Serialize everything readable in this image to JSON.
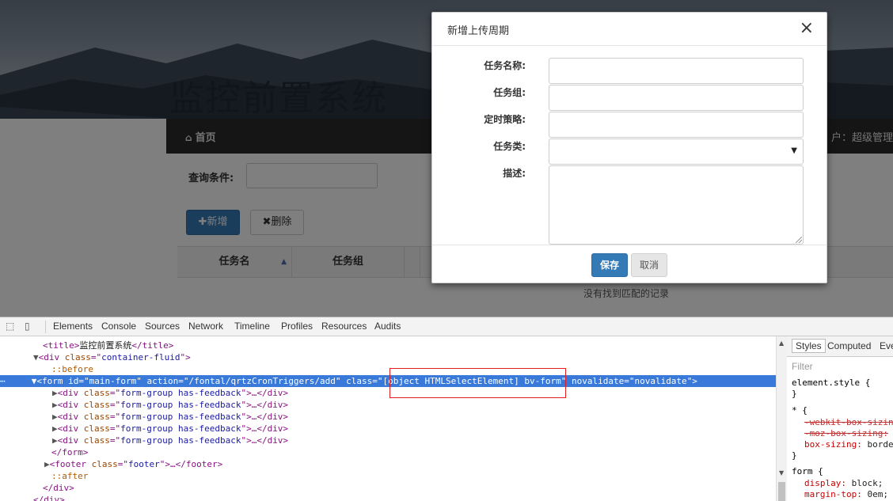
{
  "background": {
    "system_title": "监控前置系统",
    "nav": {
      "home_label": "首页",
      "user_text": "户：超级管理"
    },
    "query_label": "查询条件:",
    "buttons": {
      "add_label": "新增",
      "delete_label": "删除"
    },
    "table": {
      "headers": [
        "任务名",
        "任务组"
      ],
      "empty_text": "没有找到匹配的记录"
    }
  },
  "modal": {
    "title": "新增上传周期",
    "close_glyph": "×",
    "fields": [
      {
        "label": "任务名称:",
        "value": ""
      },
      {
        "label": "任务组:",
        "value": ""
      },
      {
        "label": "定时策略:",
        "value": ""
      },
      {
        "label": "任务类:",
        "value": ""
      },
      {
        "label": "描述:",
        "value": ""
      }
    ],
    "save_label": "保存",
    "cancel_label": "取消"
  },
  "devtools": {
    "tabs": [
      "Elements",
      "Console",
      "Sources",
      "Network",
      "Timeline",
      "Profiles",
      "Resources",
      "Audits"
    ],
    "dom": {
      "title_text": "监控前置系统",
      "container_class": "container-fluid",
      "before": "::before",
      "form_id": "main-form",
      "form_action": "/fontal/qrtzCronTriggers/add",
      "form_class": "[object HTMLSelectElement] bv-form",
      "form_novalidate": "novalidate",
      "form_group_class": "form-group has-feedback",
      "footer_class": "footer",
      "after": "::after"
    },
    "styles_panel": {
      "tabs": [
        "Styles",
        "Computed",
        "Eve"
      ],
      "filter_placeholder": "Filter",
      "rules": {
        "element_style": "element.style {",
        "universal": "* {",
        "webkit_prop": "-webkit-box-sizin",
        "moz_prop": "-moz-box-sizing:",
        "box_sizing_prop": "box-sizing:",
        "box_sizing_val": "borde",
        "form_rule": "form {",
        "display_prop": "display:",
        "display_val": "block;",
        "margin_prop": "margin-top:",
        "margin_val": "0em;",
        "close_brace": "}"
      }
    }
  },
  "colors": {
    "primary": "#337ab7",
    "navbar": "#2a2a2a",
    "selection": "#3879d9",
    "highlight": "#e02020"
  }
}
